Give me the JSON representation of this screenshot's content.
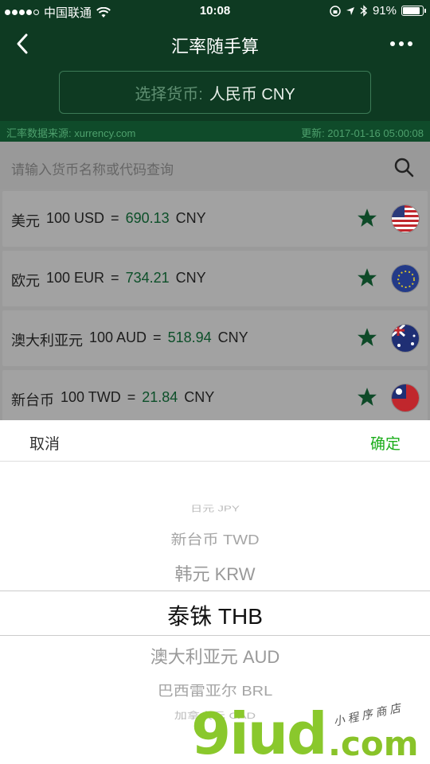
{
  "status_bar": {
    "carrier": "中国联通",
    "time": "10:08",
    "battery_percent": "91%",
    "battery_level": 0.91,
    "icons": [
      "signal-dots",
      "wifi-icon",
      "lock-rotation-icon",
      "location-arrow-icon",
      "bluetooth-icon",
      "battery-icon"
    ]
  },
  "nav": {
    "title": "汇率随手算",
    "back_icon": "chevron-left-icon",
    "more_icon": "more-dots-icon"
  },
  "selector": {
    "label": "选择货币:",
    "value": "人民币 CNY"
  },
  "info": {
    "source": "汇率数据来源: xurrency.com",
    "updated": "更新: 2017-01-16 05:00:08"
  },
  "search": {
    "placeholder": "请输入货币名称或代码查询",
    "icon": "search-icon"
  },
  "rates": [
    {
      "name": "美元",
      "amount": "100 USD",
      "eq": "=",
      "value": "690.13",
      "unit": "CNY",
      "flag": "us-flag-icon"
    },
    {
      "name": "欧元",
      "amount": "100 EUR",
      "eq": "=",
      "value": "734.21",
      "unit": "CNY",
      "flag": "eu-flag-icon"
    },
    {
      "name": "澳大利亚元",
      "amount": "100 AUD",
      "eq": "=",
      "value": "518.94",
      "unit": "CNY",
      "flag": "au-flag-icon"
    },
    {
      "name": "新台币",
      "amount": "100 TWD",
      "eq": "=",
      "value": "21.84",
      "unit": "CNY",
      "flag": "tw-flag-icon"
    }
  ],
  "picker": {
    "cancel": "取消",
    "confirm": "确定",
    "items": [
      "日元 JPY",
      "新台币 TWD",
      "韩元 KRW",
      "泰铢 THB",
      "澳大利亚元 AUD",
      "巴西雷亚尔 BRL",
      "加拿大元 CAD"
    ],
    "selected": "泰铢 THB"
  },
  "watermark": {
    "logo": "9iud",
    "domain": ".com",
    "note": "小 程 序 商 店"
  },
  "colors": {
    "header_bg": "#0e3a22",
    "accent_green": "#1aad19",
    "star": "#0e4a28"
  }
}
